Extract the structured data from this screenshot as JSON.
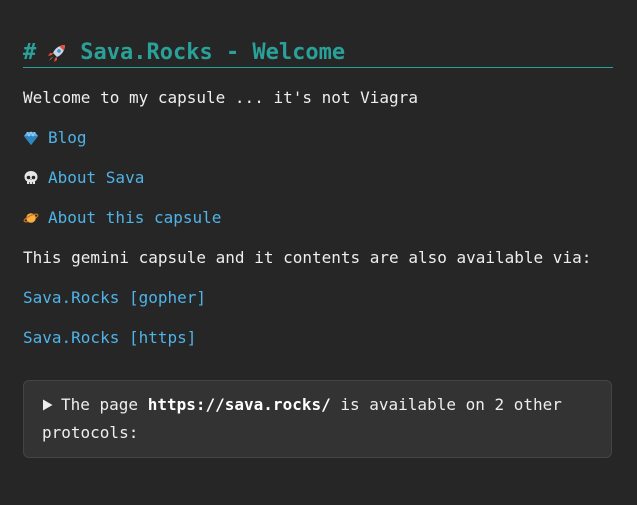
{
  "heading": {
    "hash": "#",
    "title": "Sava.Rocks - Welcome"
  },
  "intro": "Welcome to my capsule ... it's not Viagra",
  "nav_links": [
    {
      "icon": "gem-icon",
      "label": "Blog"
    },
    {
      "icon": "skull-icon",
      "label": "About Sava"
    },
    {
      "icon": "ringed-planet-icon",
      "label": "About this capsule"
    }
  ],
  "availability_text": "This gemini capsule and it contents are also available via:",
  "protocol_links": [
    {
      "label": "Sava.Rocks [gopher]"
    },
    {
      "label": "Sava.Rocks [https]"
    }
  ],
  "details": {
    "prefix": "The page ",
    "url": "https://sava.rocks/",
    "suffix": " is available on 2 other protocols:"
  },
  "colors": {
    "background": "#262626",
    "heading": "#2aa198",
    "link": "#4fb3e8",
    "text": "#eeeeee"
  }
}
